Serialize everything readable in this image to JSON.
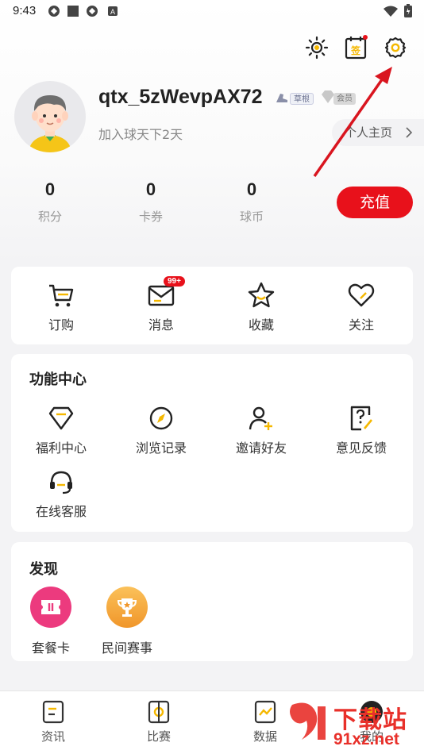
{
  "status_bar": {
    "time": "9:43"
  },
  "header": {
    "settings_icon": "gear-icon",
    "checkin_icon": "calendar-icon",
    "theme_icon": "sun-icon"
  },
  "profile": {
    "username": "qtx_5zWevpAX72",
    "level_tag": "草根",
    "member_tag": "会员",
    "joined_text": "加入球天下2天",
    "home_button": "个人主页"
  },
  "stats": [
    {
      "value": "0",
      "label": "积分"
    },
    {
      "value": "0",
      "label": "卡券"
    },
    {
      "value": "0",
      "label": "球币"
    }
  ],
  "recharge_button": "充值",
  "quick_actions": [
    {
      "label": "订购",
      "icon": "cart-icon"
    },
    {
      "label": "消息",
      "icon": "mail-icon",
      "badge": "99+"
    },
    {
      "label": "收藏",
      "icon": "star-icon"
    },
    {
      "label": "关注",
      "icon": "heart-icon"
    }
  ],
  "function_center": {
    "title": "功能中心",
    "items": [
      {
        "label": "福利中心",
        "icon": "gem-icon"
      },
      {
        "label": "浏览记录",
        "icon": "compass-icon"
      },
      {
        "label": "邀请好友",
        "icon": "add-user-icon"
      },
      {
        "label": "意见反馈",
        "icon": "feedback-icon"
      },
      {
        "label": "在线客服",
        "icon": "headset-icon"
      }
    ]
  },
  "discover": {
    "title": "发现",
    "items": [
      {
        "label": "套餐卡",
        "icon": "ticket-icon",
        "color": "#ec3a7e"
      },
      {
        "label": "民间赛事",
        "icon": "trophy-icon",
        "color": "#f5a623"
      }
    ]
  },
  "tabbar": [
    {
      "label": "资讯",
      "icon": "news-icon"
    },
    {
      "label": "比赛",
      "icon": "match-icon"
    },
    {
      "label": "数据",
      "icon": "chart-icon"
    },
    {
      "label": "我的",
      "icon": "profile-icon"
    }
  ],
  "colors": {
    "accent": "#e8111b",
    "icon_yellow": "#f5b800",
    "text": "#222222"
  },
  "watermark": {
    "line1": "下载站",
    "line2": "91xz.net"
  }
}
